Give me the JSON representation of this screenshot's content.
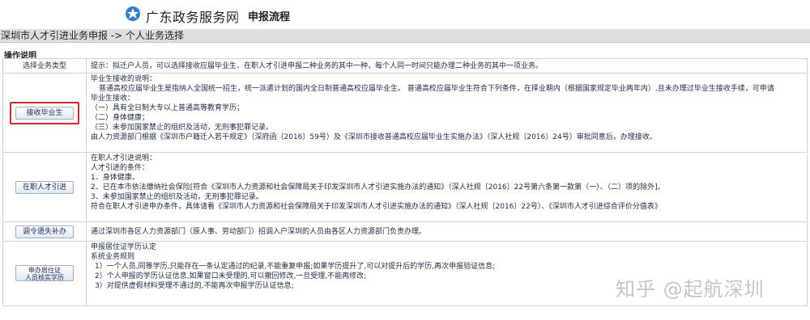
{
  "header": {
    "site_name": "广东政务服务网",
    "sub_title": "申报流程"
  },
  "breadcrumb": "深圳市人才引进业务申报 -> 个人业务选择",
  "section_title": "操作说明",
  "table": {
    "head_left": "选择业务类型",
    "head_right": "提示：拟迁户人员，可以选择接收应届毕业生、在职人才引进申报二种业务的其中一种，每个人同一时间只能办理二种业务的其中一项业务。",
    "rows": [
      {
        "button": "接收毕业生",
        "lines": [
          "毕业生接收的说明：",
          "普通高校应届毕业生是指纳入全国统一招生，统一派遣计划的国内全日制普通高校应届毕业生。 普通高校应届毕业生符合下列条件，在择业期内（根据国家规定毕业两年内）,且未办理过毕业生接收手续，可申请",
          "毕业生接收：",
          "（一）具有全日制大专以上普通高等教育学历；",
          "（二）身体健康；",
          "（三）未参加国家禁止的组织及活动，无刑事犯罪记录。",
          "由人力资源部门根据《深圳市户籍迁入若干规定》（深府函〔2016〕59号）及《深圳市接收普通高校应届毕业生实施办法》（深人社规〔2016〕24号）审批同意后，办理接收。"
        ]
      },
      {
        "button": "在职人才引进",
        "lines": [
          "在职人才引进说明：",
          "人才引进的条件：",
          "1、身体健康。",
          "2、已在本市依法缴纳社会保险[符合《深圳市人力资源和社会保障局关于印发深圳市人才引进实施办法的通知》（深人社规〔2016〕22号第六条第一款第（一）、（二）项的除外]。",
          "3、未参加国家禁止的组织及活动，无刑事犯罪记录。",
          "符合在职人才引进申办条件，具体请看《深圳市人力资源和社会保障局关于印发深圳市人才引进实施办法的通知》（深人社规〔2016〕22号）、《深圳市人才引进综合评价分值表》"
        ]
      },
      {
        "button": "调令遗失补办",
        "lines": [
          "通过深圳市各区人力资源部门（原人事、劳动部门）招调入户深圳的人员由各区人力资源部门负责办理。"
        ]
      },
      {
        "button_line1": "申办居住证",
        "button_line2": "人员核实学历",
        "lines": [
          "申报居住证学历认定",
          "系统业务规则",
          "1）一个人员,同等学历,只能存在一条认定通过的纪录,不能重复申报;如果学历提升了,可以对提升后的学历,再次申报验证信息;",
          "2）个人申报的学历认证信息,如果窗口未受理的,可以撤回修改,一旦受理,不能再修改;",
          "3）对提供虚假材料受理不通过的,不能再次申报学历认证信息;"
        ]
      }
    ]
  },
  "watermark": "知乎 @起航深圳",
  "colors": {
    "highlight_border": "#d3262a",
    "logo": "#2f7fd1",
    "breadcrumb_bg": "#dedede"
  }
}
